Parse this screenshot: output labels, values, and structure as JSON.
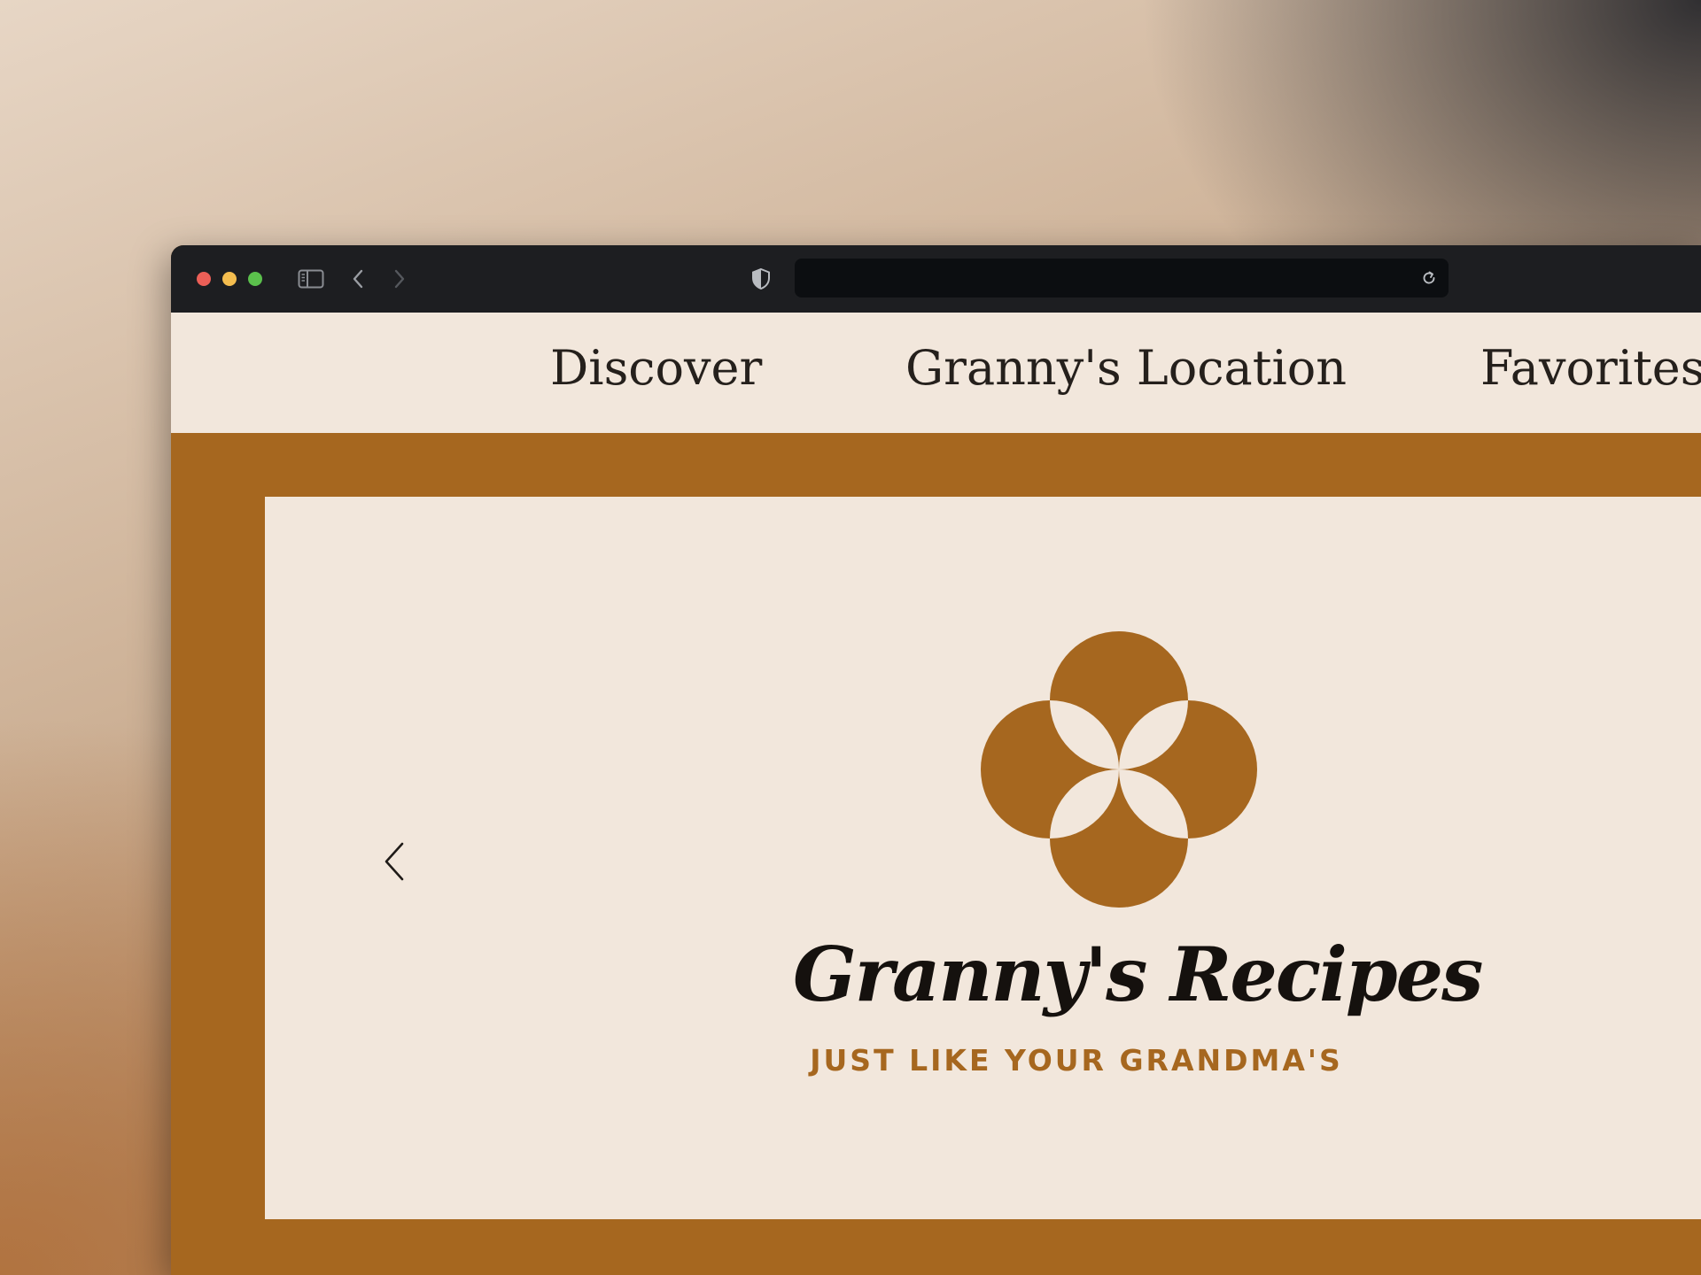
{
  "browser": {
    "url": "",
    "traffic_lights": [
      "close",
      "minimize",
      "zoom"
    ]
  },
  "nav": {
    "items": [
      {
        "label": "Discover"
      },
      {
        "label": "Granny's Location"
      },
      {
        "label": "Favorites"
      }
    ]
  },
  "hero": {
    "brand_name": "Granny's Recipes",
    "tagline": "JUST LIKE YOUR GRANDMA'S",
    "logo_icon": "four-petal-flower-icon"
  },
  "colors": {
    "accent": "#a6671f",
    "page_background": "#f2e7dc",
    "text": "#25201c",
    "titlebar": "#1d1e21"
  }
}
